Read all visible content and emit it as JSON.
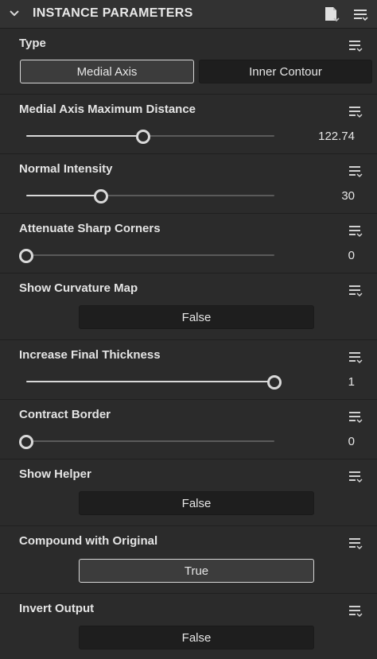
{
  "panel": {
    "title": "INSTANCE PARAMETERS",
    "icons": {
      "collapse": "chevron-down-icon",
      "preset": "preset-icon",
      "menu": "panel-menu-icon"
    }
  },
  "params": {
    "type": {
      "label": "Type",
      "options": [
        "Medial Axis",
        "Inner Contour"
      ],
      "selected": "Medial Axis"
    },
    "medial_axis_max_distance": {
      "label": "Medial Axis Maximum Distance",
      "value": "122.74",
      "level": 0.47
    },
    "normal_intensity": {
      "label": "Normal Intensity",
      "value": "30",
      "level": 0.3
    },
    "attenuate_sharp_corners": {
      "label": "Attenuate Sharp Corners",
      "value": "0",
      "level": 0
    },
    "show_curvature_map": {
      "label": "Show Curvature Map",
      "value": "False"
    },
    "increase_final_thickness": {
      "label": "Increase Final Thickness",
      "value": "1",
      "level": 1
    },
    "contract_border": {
      "label": "Contract Border",
      "value": "0",
      "level": 0
    },
    "show_helper": {
      "label": "Show Helper",
      "value": "False"
    },
    "compound_with_original": {
      "label": "Compound with Original",
      "value": "True"
    },
    "invert_output": {
      "label": "Invert Output",
      "value": "False"
    }
  },
  "colors": {
    "background": "#2b2b2b",
    "header": "#323232",
    "accent": "#d8d8d8"
  }
}
